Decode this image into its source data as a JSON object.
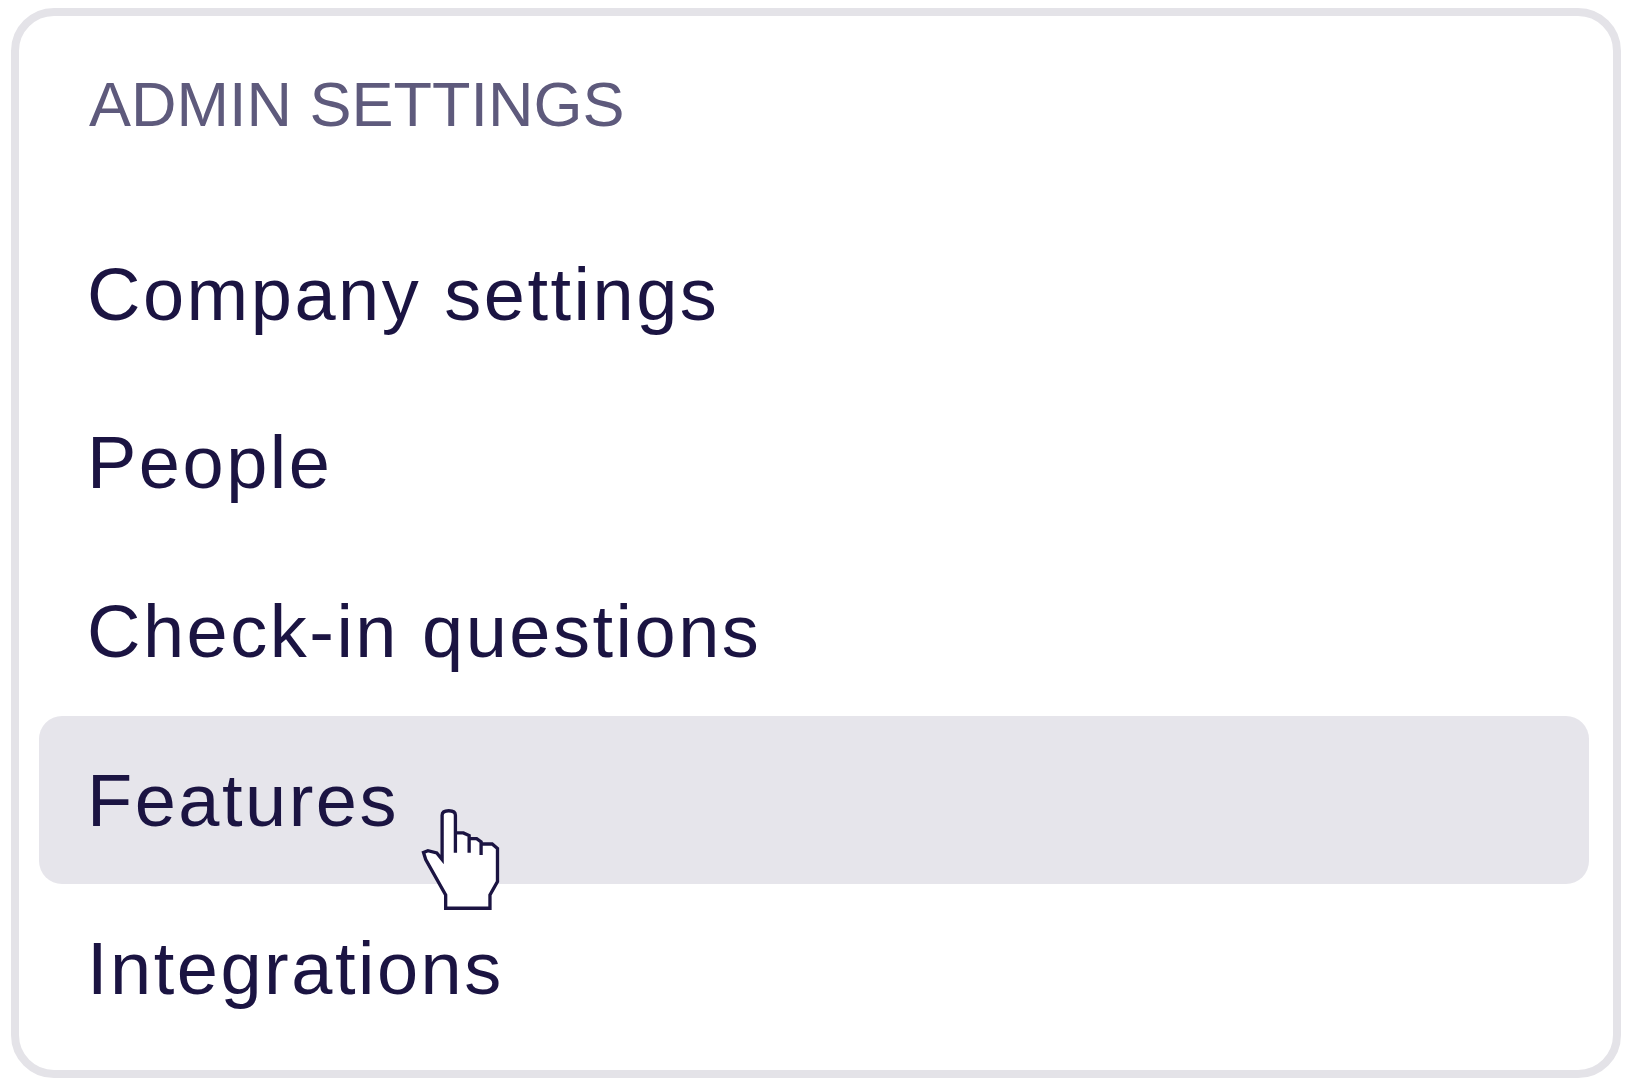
{
  "panel": {
    "heading": "ADMIN SETTINGS",
    "items": [
      {
        "label": "Company settings",
        "selected": false
      },
      {
        "label": "People",
        "selected": false
      },
      {
        "label": "Check-in questions",
        "selected": false
      },
      {
        "label": "Features",
        "selected": true
      },
      {
        "label": "Integrations",
        "selected": false
      }
    ]
  }
}
